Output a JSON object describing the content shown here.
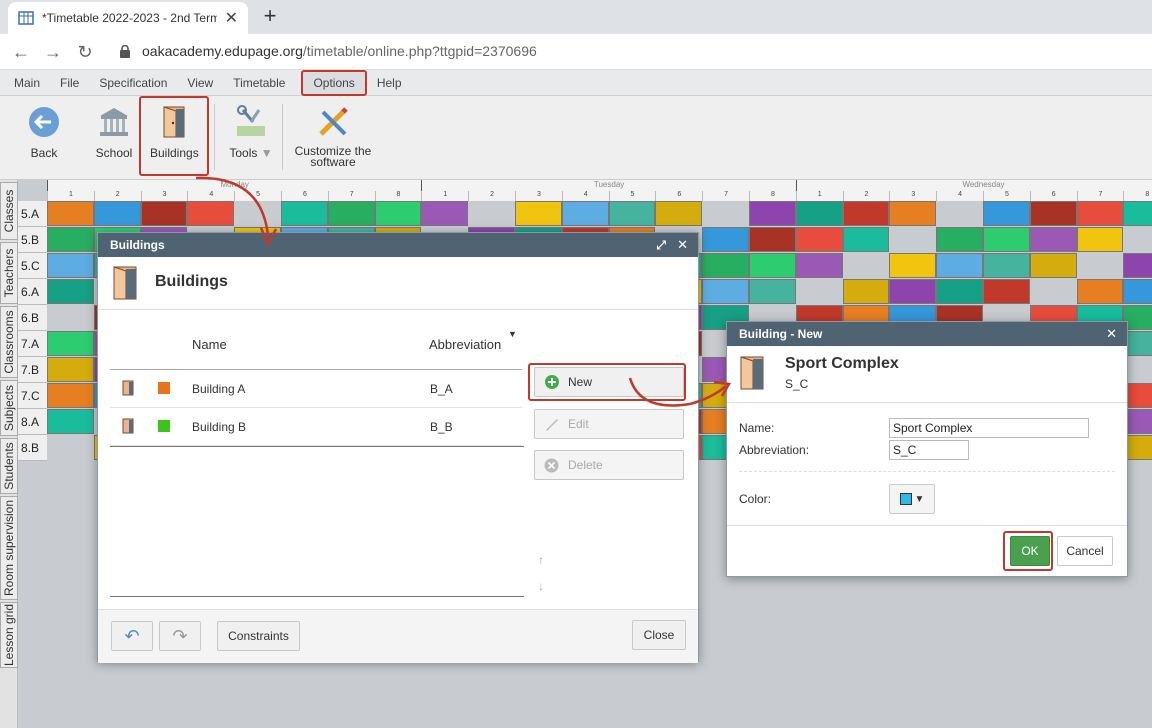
{
  "browser": {
    "tab_title": "*Timetable 2022-2023 - 2nd Term",
    "url_host": "oakacademy.edupage.org",
    "url_path": "/timetable/online.php?ttgpid=2370696"
  },
  "menu": [
    "Main",
    "File",
    "Specification",
    "View",
    "Timetable",
    "Options",
    "Help"
  ],
  "ribbon": {
    "back": "Back",
    "school": "School",
    "buildings": "Buildings",
    "tools": "Tools",
    "customize1": "Customize the",
    "customize2": "software"
  },
  "sidetabs": [
    "Classes",
    "Teachers",
    "Classrooms",
    "Subjects",
    "Students",
    "Room supervision",
    "Lesson grid"
  ],
  "timetable": {
    "days": [
      "Monday",
      "Tuesday",
      "Wednesday"
    ],
    "periods": [
      "1",
      "2",
      "3",
      "4",
      "5",
      "6",
      "7",
      "8"
    ],
    "classes": [
      "5.A",
      "5.B",
      "5.C",
      "6.A",
      "6.B",
      "7.A",
      "7.B",
      "7.C",
      "8.A",
      "8.B"
    ]
  },
  "buildings_dialog": {
    "title": "Buildings",
    "heading": "Buildings",
    "col_name": "Name",
    "col_abbr": "Abbreviation",
    "rows": [
      {
        "name": "Building A",
        "abbr": "B_A",
        "color": "#e8731f"
      },
      {
        "name": "Building B",
        "abbr": "B_B",
        "color": "#3ec31d"
      }
    ],
    "new_label": "New",
    "edit_label": "Edit",
    "delete_label": "Delete",
    "constraints_label": "Constraints",
    "close_label": "Close"
  },
  "new_dialog": {
    "title": "Building - New",
    "heading": "Sport Complex",
    "sub": "S_C",
    "name_label": "Name:",
    "name_value": "Sport Complex",
    "abbr_label": "Abbreviation:",
    "abbr_value": "S_C",
    "color_label": "Color:",
    "color_value": "#2fb9e8",
    "ok_label": "OK",
    "cancel_label": "Cancel"
  }
}
